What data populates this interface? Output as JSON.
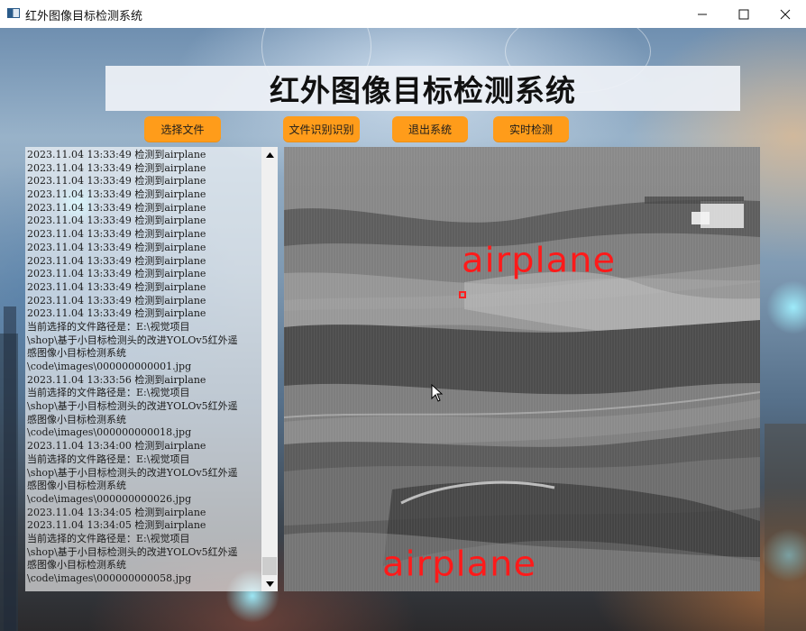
{
  "window": {
    "title": "红外图像目标检测系统"
  },
  "header": {
    "title": "红外图像目标检测系统"
  },
  "buttons": {
    "select_file": "选择文件",
    "file_recognition": "文件识别识别",
    "exit_system": "退出系统",
    "realtime_detection": "实时检测"
  },
  "log": {
    "lines": [
      "2023.11.04 13:33:49 检测到airplane",
      "2023.11.04 13:33:49 检测到airplane",
      "2023.11.04 13:33:49 检测到airplane",
      "2023.11.04 13:33:49 检测到airplane",
      "2023.11.04 13:33:49 检测到airplane",
      "2023.11.04 13:33:49 检测到airplane",
      "2023.11.04 13:33:49 检测到airplane",
      "2023.11.04 13:33:49 检测到airplane",
      "2023.11.04 13:33:49 检测到airplane",
      "2023.11.04 13:33:49 检测到airplane",
      "2023.11.04 13:33:49 检测到airplane",
      "2023.11.04 13:33:49 检测到airplane",
      "2023.11.04 13:33:49 检测到airplane",
      "当前选择的文件路径是：E:\\视觉项目",
      "\\shop\\基于小目标检测头的改进YOLOv5红外遥",
      "感图像小目标检测系统",
      "\\code\\images\\000000000001.jpg",
      "2023.11.04 13:33:56 检测到airplane",
      "当前选择的文件路径是：E:\\视觉项目",
      "\\shop\\基于小目标检测头的改进YOLOv5红外遥",
      "感图像小目标检测系统",
      "\\code\\images\\000000000018.jpg",
      "2023.11.04 13:34:00 检测到airplane",
      "当前选择的文件路径是：E:\\视觉项目",
      "\\shop\\基于小目标检测头的改进YOLOv5红外遥",
      "感图像小目标检测系统",
      "\\code\\images\\000000000026.jpg",
      "2023.11.04 13:34:05 检测到airplane",
      "2023.11.04 13:34:05 检测到airplane",
      "当前选择的文件路径是：E:\\视觉项目",
      "\\shop\\基于小目标检测头的改进YOLOv5红外遥",
      "感图像小目标检测系统",
      "\\code\\images\\000000000058.jpg"
    ]
  },
  "detection_view": {
    "labels": [
      "airplane",
      "airplane"
    ],
    "label_color": "#ff1a1a"
  },
  "colors": {
    "button_bg": "#ff9c1a",
    "header_bg": "#eef1f6"
  },
  "icons": {
    "minimize": "minimize-icon",
    "maximize": "maximize-icon",
    "close": "close-icon",
    "scroll_up": "triangle-up-icon",
    "scroll_down": "triangle-down-icon"
  }
}
